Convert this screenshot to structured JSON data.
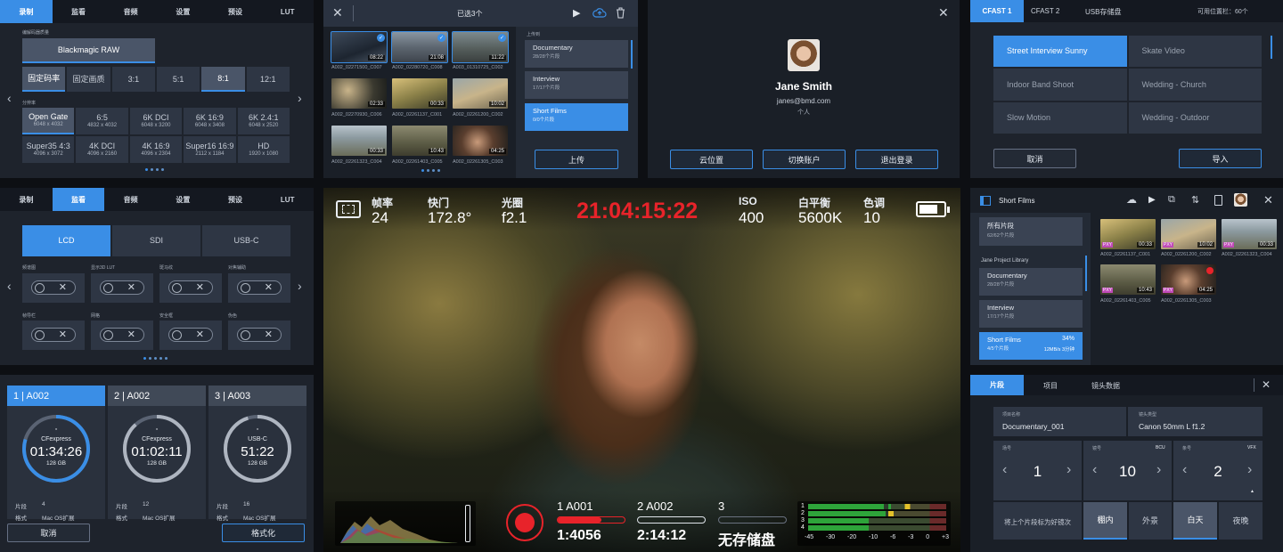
{
  "record_panel": {
    "tabs": [
      "录制",
      "监看",
      "音频",
      "设置",
      "预设",
      "LUT"
    ],
    "codec_label": "编解码器质量",
    "codec": "Blackmagic RAW",
    "quality_options": [
      "固定码率",
      "固定画质",
      "3:1",
      "5:1",
      "8:1",
      "12:1"
    ],
    "resolution_label": "分辨率",
    "resolutions": [
      {
        "name": "Open Gate",
        "size": "6048 x 4032"
      },
      {
        "name": "6:5",
        "size": "4832 x 4032"
      },
      {
        "name": "6K DCI",
        "size": "6048 x 3200"
      },
      {
        "name": "6K 16:9",
        "size": "6048 x 3408"
      },
      {
        "name": "6K 2.4:1",
        "size": "6048 x 2520"
      },
      {
        "name": "Super35 4:3",
        "size": "4096 x 3072"
      },
      {
        "name": "4K DCI",
        "size": "4096 x 2160"
      },
      {
        "name": "4K 16:9",
        "size": "4096 x 2304"
      },
      {
        "name": "Super16 16:9",
        "size": "2112 x 1184"
      },
      {
        "name": "HD",
        "size": "1920 x 1080"
      }
    ]
  },
  "monitor_panel": {
    "tabs": [
      "录制",
      "监看",
      "音频",
      "设置",
      "预设",
      "LUT"
    ],
    "outputs": [
      "LCD",
      "SDI",
      "USB-C"
    ],
    "toggle_labels": [
      "频谱图",
      "显示3D LUT",
      "斑马纹",
      "对焦辅助",
      "帧导栏",
      "网格",
      "安全框",
      "伪色"
    ]
  },
  "upload_panel": {
    "title": "已选3个",
    "upload_to_label": "上传到",
    "thumbs": [
      {
        "name": "A002_02271500_C007",
        "dur": "08:22",
        "sel": true
      },
      {
        "name": "A002_02280720_C008",
        "dur": "21:08",
        "sel": true
      },
      {
        "name": "A003_01310725_C002",
        "dur": "11:22",
        "sel": true
      },
      {
        "name": "A002_02270930_C006",
        "dur": "02:33",
        "sel": false
      },
      {
        "name": "A002_02261137_C001",
        "dur": "00:33",
        "sel": false
      },
      {
        "name": "A002_02261200_C002",
        "dur": "10:02",
        "sel": false
      },
      {
        "name": "A002_02261323_C004",
        "dur": "00:33",
        "sel": false
      },
      {
        "name": "A002_02261403_C005",
        "dur": "10:43",
        "sel": false
      },
      {
        "name": "A002_02261305_C003",
        "dur": "04:25",
        "sel": false
      }
    ],
    "destinations": [
      {
        "name": "Documentary",
        "sub": "28/28个片段"
      },
      {
        "name": "Interview",
        "sub": "17/17个片段"
      },
      {
        "name": "Short Films",
        "sub": "0/0个片段"
      }
    ],
    "upload_button": "上传"
  },
  "account_panel": {
    "name": "Jane Smith",
    "email": "janes@bmd.com",
    "type": "个人",
    "buttons": [
      "云位置",
      "切换账户",
      "退出登录"
    ]
  },
  "presets_panel": {
    "tabs": [
      "CFAST 1",
      "CFAST 2",
      "USB存储盘"
    ],
    "available": "可用位置栏：60个",
    "presets": [
      "Street Interview Sunny",
      "Skate Video",
      "Indoor Band Shoot",
      "Wedding  - Church",
      "Slow Motion",
      "Wedding - Outdoor"
    ],
    "cancel": "取消",
    "import": "导入"
  },
  "hud": {
    "fps_label": "帧率",
    "fps": "24",
    "shutter_label": "快门",
    "shutter": "172.8°",
    "iris_label": "光圈",
    "iris": "f2.1",
    "timecode": "21:04:15:22",
    "iso_label": "ISO",
    "iso": "400",
    "wb_label": "白平衡",
    "wb": "5600K",
    "tint_label": "色调",
    "tint": "10",
    "slot1_label": "1 A001",
    "slot1_time": "1:4056",
    "slot2_label": "2 A002",
    "slot2_time": "2:14:12",
    "slot3_label": "3",
    "slot3_time": "无存储盘",
    "meter_scale": [
      "-45",
      "-30",
      "-20",
      "-10",
      "-6",
      "-3",
      "0",
      "+3"
    ],
    "meter_channels": [
      "1",
      "2",
      "3",
      "4"
    ]
  },
  "library_panel": {
    "title": "Short Films",
    "all_clips": "所有片段",
    "all_clips_sub": "62/62个片段",
    "library_name": "Jane Project Library",
    "projects": [
      {
        "name": "Documentary",
        "sub": "28/28个片段"
      },
      {
        "name": "Interview",
        "sub": "17/17个片段"
      },
      {
        "name": "Short Films",
        "sub": "4/5个片段",
        "pct": "34%",
        "rate": "12MB/s 3分钟"
      }
    ],
    "thumbs": [
      {
        "name": "A002_02261137_C001",
        "dur": "00:33"
      },
      {
        "name": "A002_02261200_C002",
        "dur": "10:02"
      },
      {
        "name": "A002_02261323_C004",
        "dur": "00:33"
      },
      {
        "name": "A002_02261403_C005",
        "dur": "10:43"
      },
      {
        "name": "A002_02261305_C003",
        "dur": "04:25"
      }
    ]
  },
  "media_panel": {
    "tabs": [
      "1 | A002",
      "2 | A002",
      "3 | A003"
    ],
    "cards": [
      {
        "type": "CFexpress",
        "time": "01:34:26",
        "size": "128 GB",
        "clips": "4",
        "format": "Mac OS扩展"
      },
      {
        "type": "CFexpress",
        "time": "01:02:11",
        "size": "128 GB",
        "clips": "12",
        "format": "Mac OS扩展"
      },
      {
        "type": "USB-C",
        "time": "51:22",
        "size": "128 GB",
        "clips": "16",
        "format": "Mac OS扩展"
      }
    ],
    "clips_label": "片段",
    "format_label": "格式",
    "cancel": "取消",
    "format_button": "格式化"
  },
  "metadata_panel": {
    "tabs": [
      "片段",
      "项目",
      "镜头数据"
    ],
    "reel_label": "项目名称",
    "reel": "Documentary_001",
    "lens_label": "镜头类型",
    "lens": "Canon 50mm L f1.2",
    "scene_label": "场号",
    "scene": "1",
    "shot_label": "镜号",
    "shot": "10",
    "shot_tag": "BCU",
    "take_label": "条号",
    "take": "2",
    "take_tag": "VFX",
    "good_take": "将上个片段标为好镜次",
    "options": [
      "棚内",
      "外景",
      "白天",
      "夜晚"
    ]
  }
}
